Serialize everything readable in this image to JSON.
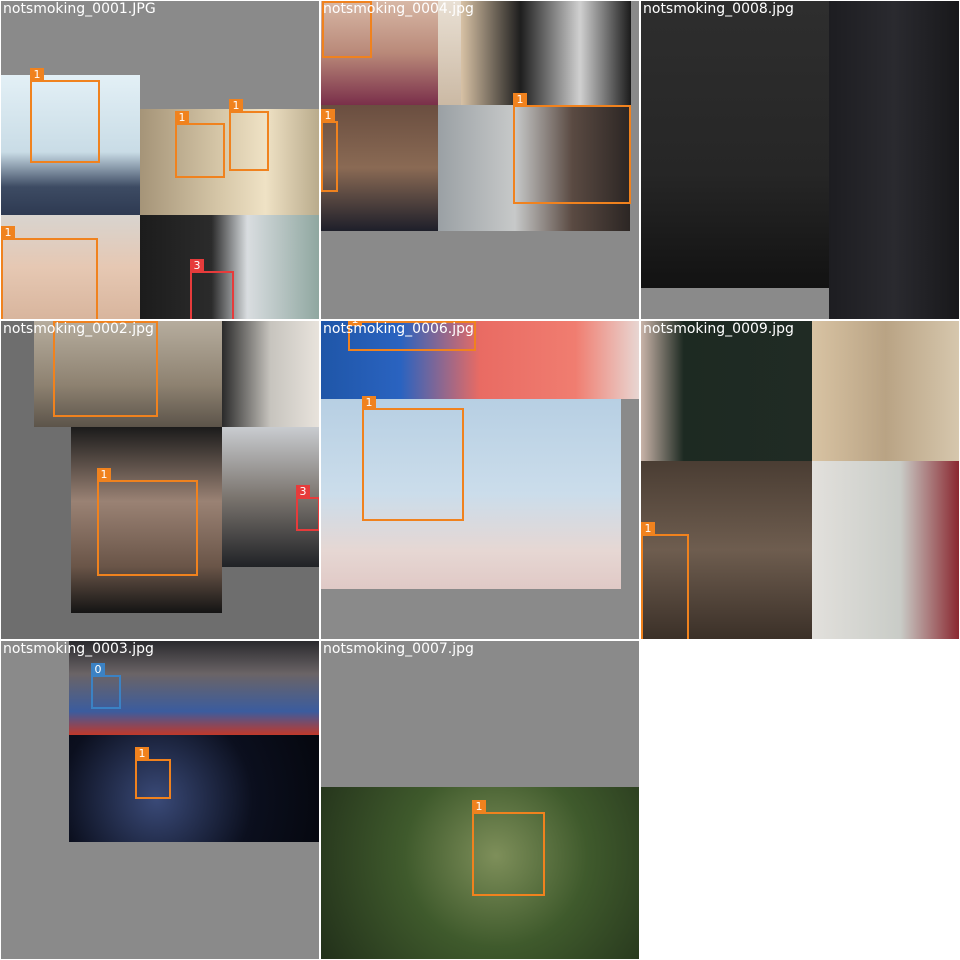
{
  "tiles": [
    {
      "title": "notsmoking_0001.JPG",
      "boxes": [
        {
          "label": "1"
        },
        {
          "label": "1"
        },
        {
          "label": "1"
        },
        {
          "label": "1"
        },
        {
          "label": "3"
        }
      ]
    },
    {
      "title": "notsmoking_0004.jpg",
      "boxes": [
        {
          "label": "1"
        },
        {
          "label": "1"
        }
      ]
    },
    {
      "title": "notsmoking_0008.jpg",
      "boxes": []
    },
    {
      "title": "notsmoking_0002.jpg",
      "boxes": [
        {
          "label": "1"
        },
        {
          "label": "1"
        },
        {
          "label": "3"
        }
      ]
    },
    {
      "title": "notsmoking_0006.jpg",
      "boxes": [
        {
          "label": "1"
        },
        {
          "label": "1"
        }
      ]
    },
    {
      "title": "notsmoking_0009.jpg",
      "boxes": [
        {
          "label": "1"
        }
      ]
    },
    {
      "title": "notsmoking_0003.jpg",
      "boxes": [
        {
          "label": "0"
        },
        {
          "label": "1"
        }
      ]
    },
    {
      "title": "notsmoking_0007.jpg",
      "boxes": [
        {
          "label": "1"
        }
      ]
    }
  ],
  "colors": {
    "class_1": "#f0821e",
    "class_3": "#e63b3b",
    "class_0": "#3b82c4",
    "tile_bg": "#8a8a8a"
  }
}
